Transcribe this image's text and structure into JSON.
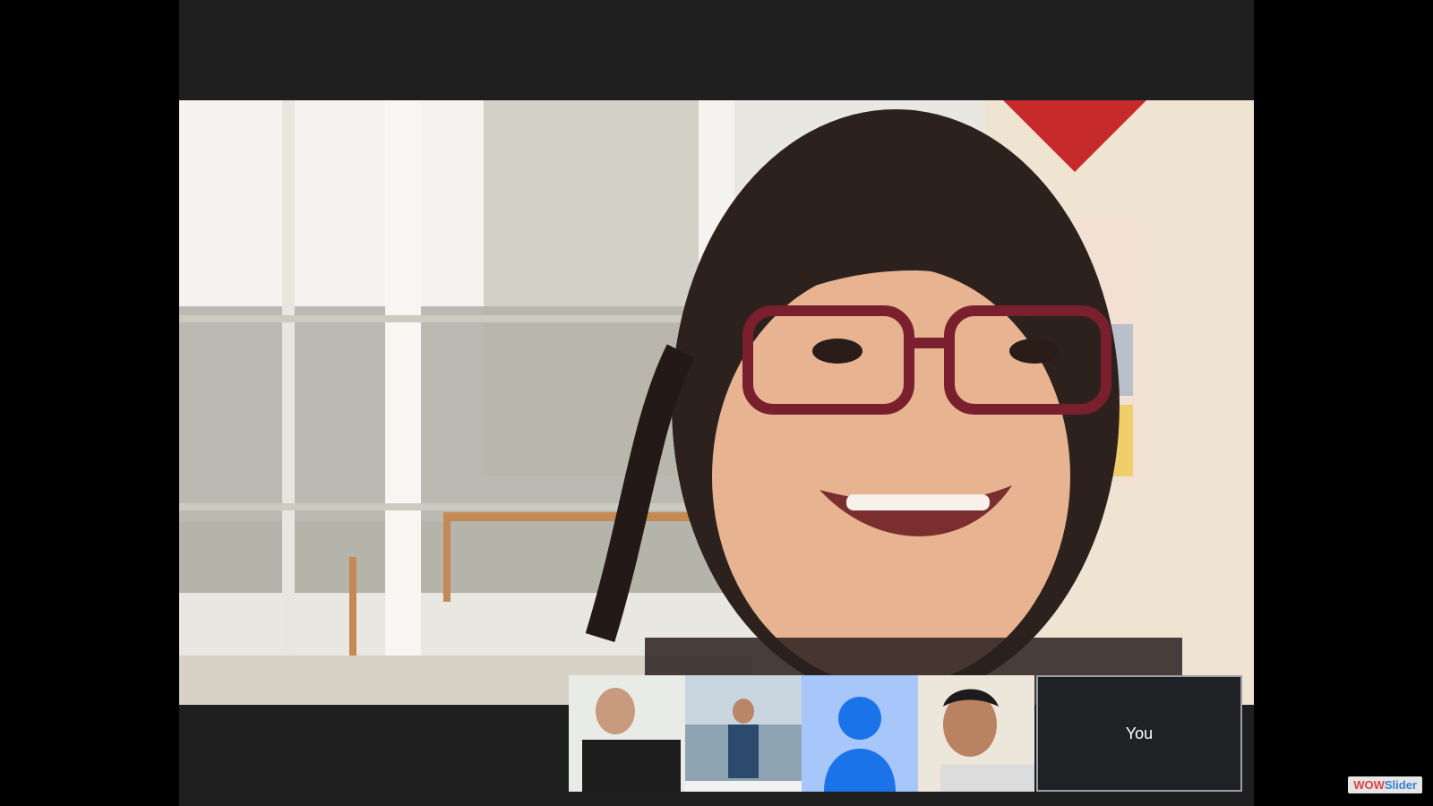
{
  "meeting": {
    "self_tile_label": "You"
  },
  "participants": [
    {
      "kind": "video",
      "icon": "participant-video"
    },
    {
      "kind": "video",
      "icon": "participant-video"
    },
    {
      "kind": "avatar-placeholder",
      "icon": "person-icon"
    },
    {
      "kind": "video",
      "icon": "participant-video"
    }
  ],
  "watermark": {
    "part1": "WOW",
    "part2": "Slider"
  },
  "colors": {
    "background": "#000000",
    "window": "#1f1f1f",
    "placeholder_bg": "#a7c7fa",
    "avatar_fg": "#1a73e8",
    "self_border": "#9aa0a6"
  }
}
